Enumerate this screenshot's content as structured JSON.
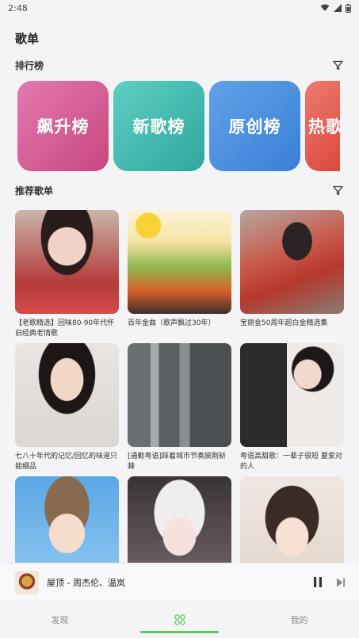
{
  "status": {
    "time": "2:48"
  },
  "page": {
    "title": "歌单"
  },
  "ranking": {
    "label": "排行榜",
    "cards": [
      {
        "label": "飙升榜"
      },
      {
        "label": "新歌榜"
      },
      {
        "label": "原创榜"
      },
      {
        "label": "热歌榜"
      }
    ]
  },
  "recommend": {
    "label": "推荐歌单",
    "items": [
      {
        "title": "【老歌精选】回味80-90年代怀旧经典老情歌"
      },
      {
        "title": "百年金曲（歌声飘过30年）"
      },
      {
        "title": "宝丽金50周年超白金精选集"
      },
      {
        "title": "七八十年代的记忆/回忆的味道只能细品"
      },
      {
        "title": "[通勤粤语]踩着城市节奏披荆斩棘"
      },
      {
        "title": "粤语高甜歌：一辈子很短 要爱对的人"
      },
      {
        "title": ""
      },
      {
        "title": ""
      },
      {
        "title": ""
      }
    ]
  },
  "player": {
    "now_playing": "屋顶 - 周杰伦、温岚"
  },
  "tabs": [
    {
      "label": "发现"
    },
    {
      "label": ""
    },
    {
      "label": "我的"
    }
  ],
  "colors": {
    "accent": "#5cc95e"
  }
}
